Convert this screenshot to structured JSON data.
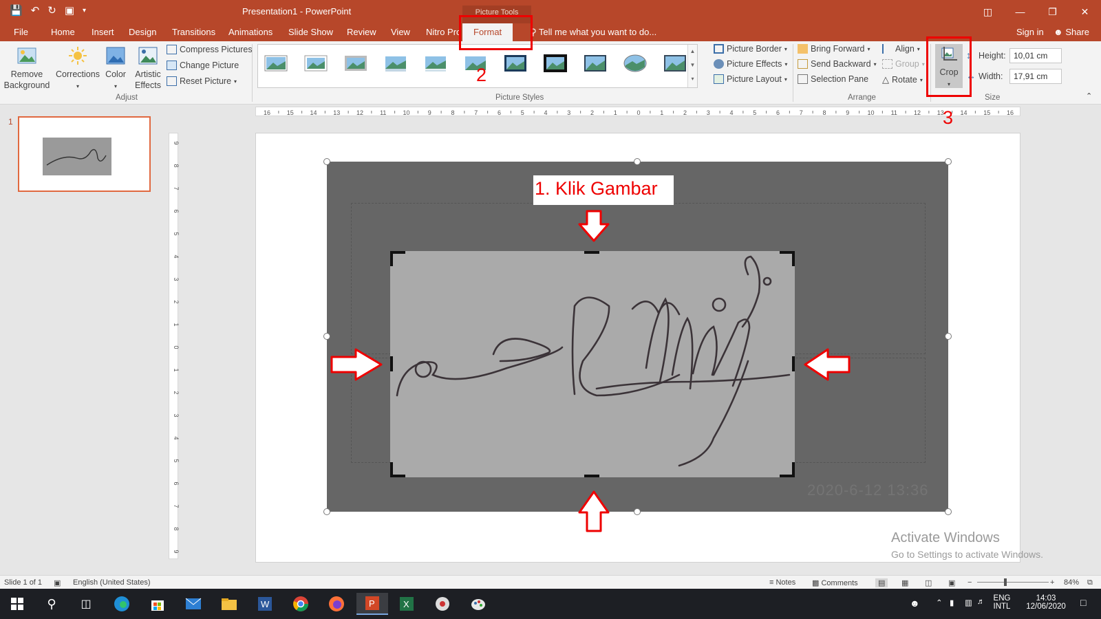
{
  "window": {
    "title": "Presentation1 - PowerPoint",
    "contextual_tab_group": "Picture Tools"
  },
  "tabs": [
    "File",
    "Home",
    "Insert",
    "Design",
    "Transitions",
    "Animations",
    "Slide Show",
    "Review",
    "View",
    "Nitro Pro",
    "Format"
  ],
  "active_tab": "Format",
  "tell_me": "Tell me what you want to do...",
  "account": {
    "sign_in": "Sign in",
    "share": "Share"
  },
  "ribbon": {
    "remove_bg": "Remove Background",
    "corrections": "Corrections",
    "color": "Color",
    "artistic": "Artistic Effects",
    "compress": "Compress Pictures",
    "change": "Change Picture",
    "reset": "Reset Picture",
    "adjust_label": "Adjust",
    "styles_label": "Picture Styles",
    "border": "Picture Border",
    "effects": "Picture Effects",
    "layout": "Picture Layout",
    "bring_forward": "Bring Forward",
    "send_backward": "Send Backward",
    "selection_pane": "Selection Pane",
    "align": "Align",
    "group": "Group",
    "rotate": "Rotate",
    "arrange_label": "Arrange",
    "crop": "Crop",
    "height_label": "Height:",
    "height_value": "10,01 cm",
    "width_label": "Width:",
    "width_value": "17,91 cm",
    "size_label": "Size"
  },
  "ruler_h": [
    "16",
    "15",
    "14",
    "13",
    "12",
    "11",
    "10",
    "9",
    "8",
    "7",
    "6",
    "5",
    "4",
    "3",
    "2",
    "1",
    "0",
    "1",
    "2",
    "3",
    "4",
    "5",
    "6",
    "7",
    "8",
    "9",
    "10",
    "11",
    "12",
    "13",
    "14",
    "15",
    "16"
  ],
  "ruler_v": [
    "9",
    "8",
    "7",
    "6",
    "5",
    "4",
    "3",
    "2",
    "1",
    "0",
    "1",
    "2",
    "3",
    "4",
    "5",
    "6",
    "7",
    "8",
    "9"
  ],
  "slide_panel": {
    "slide_number": "1"
  },
  "annotations": {
    "step1": "1. Klik Gambar",
    "step2": "2",
    "step3": "3"
  },
  "photo": {
    "timestamp": "2020-6-12 13:36"
  },
  "activate": {
    "line1": "Activate Windows",
    "line2": "Go to Settings to activate Windows."
  },
  "status": {
    "slide": "Slide 1 of 1",
    "language": "English (United States)",
    "notes": "Notes",
    "comments": "Comments",
    "zoom": "84%"
  },
  "taskbar": {
    "language": "ENG",
    "layout": "INTL",
    "time": "14:03",
    "date": "12/06/2020"
  },
  "colors": {
    "accent": "#b7472a",
    "annotation": "#e00000"
  }
}
